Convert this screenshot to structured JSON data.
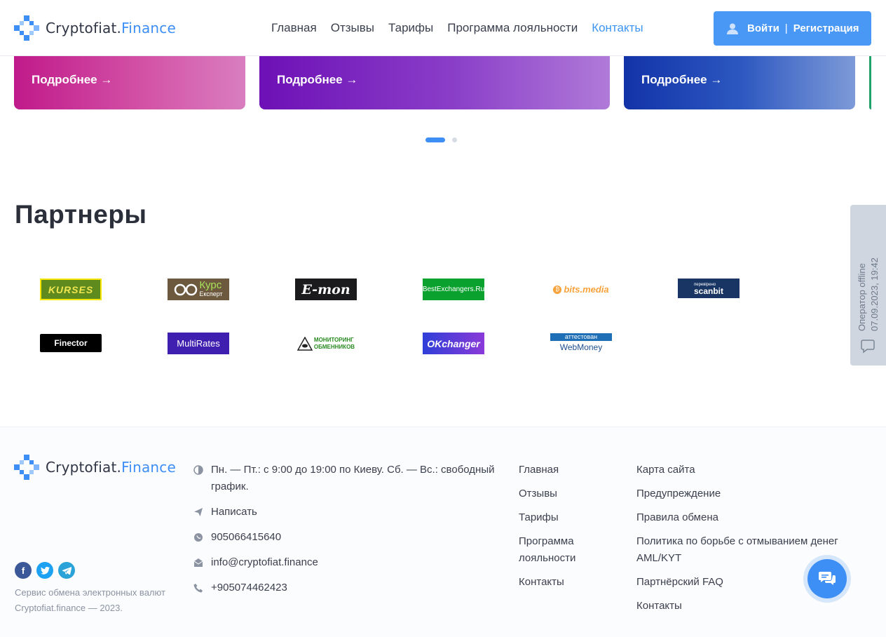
{
  "brand": {
    "name_main": "Cryptofiat.",
    "name_accent": "Finance",
    "accent_color": "#3d8ef5"
  },
  "nav": {
    "items": [
      {
        "label": "Главная"
      },
      {
        "label": "Отзывы"
      },
      {
        "label": "Тарифы"
      },
      {
        "label": "Программа лояльности"
      },
      {
        "label": "Контакты",
        "active": true
      }
    ]
  },
  "auth": {
    "login": "Войти",
    "separator": "|",
    "register": "Регистрация"
  },
  "cards": [
    {
      "cta": "Подробнее →"
    },
    {
      "cta": "Подробнее →"
    },
    {
      "cta": "Подробнее →"
    }
  ],
  "slider": {
    "total": 2,
    "active": 1
  },
  "partners": {
    "title": "Партнеры",
    "logos": [
      {
        "text": "KURSES"
      },
      {
        "text": "Курс",
        "sub": "Експерт"
      },
      {
        "text": "E-mon"
      },
      {
        "text": "BestExchangers.Ru"
      },
      {
        "text": "bits.media"
      },
      {
        "text": "scanbit",
        "sub": "перевірено"
      },
      {
        "text": "Finector"
      },
      {
        "text": "MultiRates"
      },
      {
        "text": "МОНИТОРИНГ",
        "sub": "ОБМЕННИКОВ"
      },
      {
        "text": "OKchanger"
      },
      {
        "text": "WebMoney",
        "sub": "аттестован"
      }
    ]
  },
  "operator": {
    "status": "Оператор offline",
    "datetime": "07.09.2023, 19:42"
  },
  "footer": {
    "schedule": "Пн. — Пт.: с 9:00 до 19:00 по Киеву. Сб. — Вс.: свободный график.",
    "write": "Написать",
    "whatsapp": "905066415640",
    "email": "info@cryptofiat.finance",
    "phone": "+905074462423",
    "copyright_line1": "Сервис обмена электронных валют",
    "copyright_line2": "Cryptofiat.finance — 2023.",
    "col1": [
      "Главная",
      "Отзывы",
      "Тарифы",
      "Программа лояльности",
      "Контакты"
    ],
    "col2": [
      "Карта сайта",
      "Предупреждение",
      "Правила обмена",
      "Политика по борьбе с отмыванием денег AML/KYT",
      "Партнёрский FAQ",
      "Контакты"
    ],
    "social": [
      "facebook",
      "twitter",
      "telegram"
    ]
  }
}
